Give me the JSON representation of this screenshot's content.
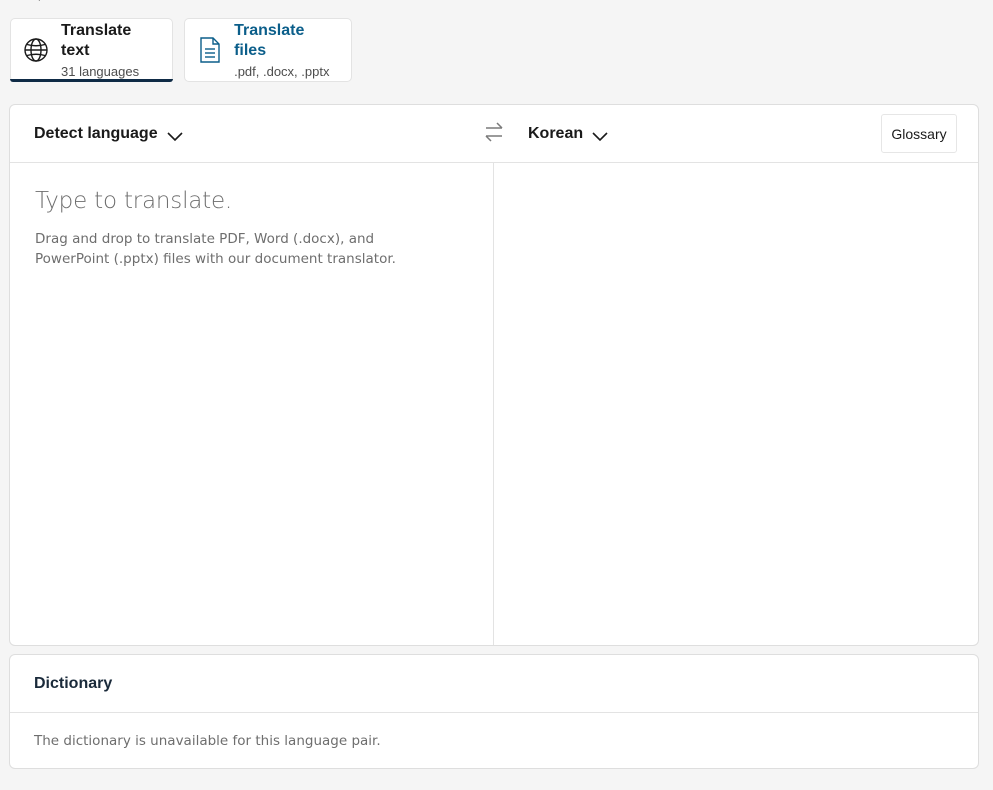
{
  "tabs": [
    {
      "title": "Translate text",
      "subtitle": "31 languages",
      "icon": "globe-icon",
      "active": true
    },
    {
      "title": "Translate files",
      "subtitle": ".pdf, .docx, .pptx",
      "icon": "document-icon",
      "active": false
    }
  ],
  "translator": {
    "source_language": "Detect language",
    "target_language": "Korean",
    "swap_icon": "swap-arrows-icon",
    "glossary_label": "Glossary",
    "placeholder": "Type to translate.",
    "hint": "Drag and drop to translate PDF, Word (.docx), and PowerPoint (.pptx) files with our document translator."
  },
  "dictionary": {
    "title": "Dictionary",
    "message": "The dictionary is unavailable for this language pair."
  },
  "colors": {
    "accent": "#0f2b46",
    "link": "#0b5e8a",
    "background": "#f5f5f5"
  }
}
